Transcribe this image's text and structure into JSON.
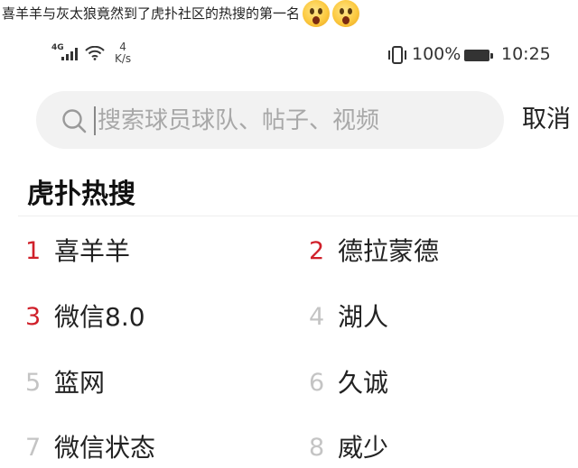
{
  "caption": {
    "text": "喜羊羊与灰太狼竟然到了虎扑社区的热搜的第一名",
    "emojis": [
      "astonished-face-emoji",
      "astonished-face-emoji"
    ]
  },
  "status_bar": {
    "network_type": "4G",
    "net_speed_value": "4",
    "net_speed_unit": "K/s",
    "battery_percent": "100%",
    "time": "10:25"
  },
  "search": {
    "placeholder": "搜索球员球队、帖子、视频",
    "cancel_label": "取消"
  },
  "hot_search": {
    "title": "虎扑热搜",
    "items": [
      {
        "rank": "1",
        "term": "喜羊羊"
      },
      {
        "rank": "2",
        "term": "德拉蒙德"
      },
      {
        "rank": "3",
        "term": "微信8.0"
      },
      {
        "rank": "4",
        "term": "湖人"
      },
      {
        "rank": "5",
        "term": "篮网"
      },
      {
        "rank": "6",
        "term": "久诚"
      },
      {
        "rank": "7",
        "term": "微信状态"
      },
      {
        "rank": "8",
        "term": "威少"
      }
    ]
  },
  "colors": {
    "top_rank": "#d0202a",
    "normal_rank": "#c4c4c4",
    "search_bg": "#f2f2f2"
  }
}
